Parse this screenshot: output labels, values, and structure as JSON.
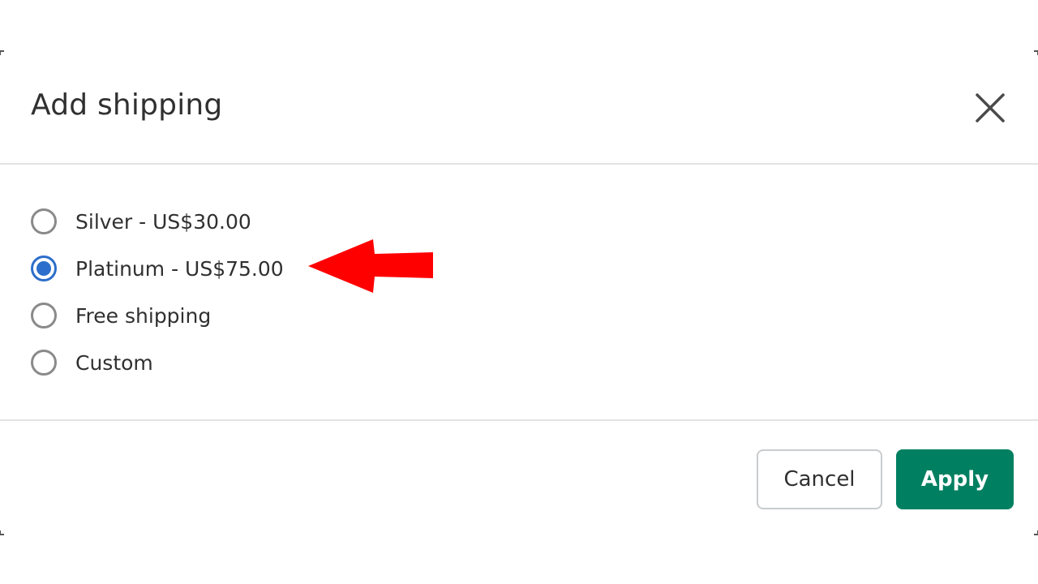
{
  "dialog": {
    "title": "Add shipping",
    "close_icon": "close-icon"
  },
  "shipping_options": [
    {
      "label": "Silver - US$30.00",
      "selected": false
    },
    {
      "label": "Platinum - US$75.00",
      "selected": true
    },
    {
      "label": "Free shipping",
      "selected": false
    },
    {
      "label": "Custom",
      "selected": false
    }
  ],
  "annotation": {
    "type": "arrow-left",
    "color": "#ff0000",
    "points_to": "Platinum - US$75.00"
  },
  "footer": {
    "cancel_label": "Cancel",
    "apply_label": "Apply"
  },
  "colors": {
    "accent_radio": "#2c6ecb",
    "primary_button": "#008060"
  }
}
